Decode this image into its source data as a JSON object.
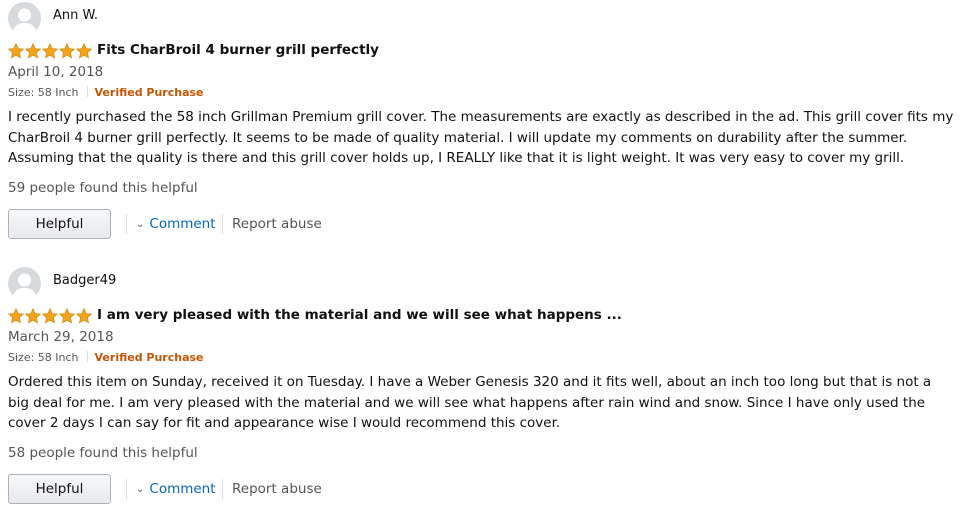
{
  "colors": {
    "star": "#f4a41c",
    "verified": "#c45500",
    "link": "#0066c0",
    "muted": "#555555"
  },
  "reviews": [
    {
      "reviewer": "Ann W.",
      "rating": 5,
      "title": "Fits CharBroil 4 burner grill perfectly",
      "date": "April 10, 2018",
      "size": "Size: 58 Inch",
      "verified": "Verified Purchase",
      "body": "I recently purchased the 58 inch Grillman Premium grill cover. The measurements are exactly as described in the ad. This grill cover fits my CharBroil 4 burner grill perfectly. It seems to be made of quality material. I will update my comments on durability after the summer. Assuming that the quality is there and this grill cover holds up, I REALLY like that it is light weight. It was very easy to cover my grill.",
      "helpful_count": "59 people found this helpful",
      "helpful_label": "Helpful",
      "comment_label": "Comment",
      "report_label": "Report abuse"
    },
    {
      "reviewer": "Badger49",
      "rating": 5,
      "title": "I am very pleased with the material and we will see what happens ...",
      "date": "March 29, 2018",
      "size": "Size: 58 Inch",
      "verified": "Verified Purchase",
      "body": "Ordered this item on Sunday, received it on Tuesday. I have a Weber Genesis 320 and it fits well, about an inch too long but that is not a big deal for me. I am very pleased with the material and we will see what happens after rain wind and snow. Since I have only used the cover 2 days I can say for fit and appearance wise I would recommend this cover.",
      "helpful_count": "58 people found this helpful",
      "helpful_label": "Helpful",
      "comment_label": "Comment",
      "report_label": "Report abuse"
    }
  ]
}
